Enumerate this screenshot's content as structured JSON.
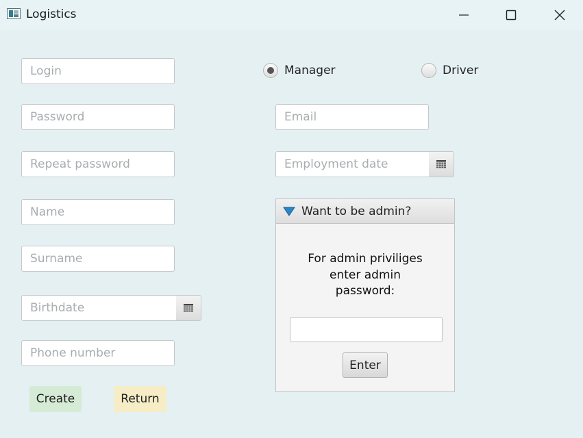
{
  "window": {
    "title": "Logistics",
    "controls": [
      "minimize-icon",
      "maximize-icon",
      "close-icon"
    ]
  },
  "form_left": {
    "login_placeholder": "Login",
    "password_placeholder": "Password",
    "repeat_password_placeholder": "Repeat password",
    "name_placeholder": "Name",
    "surname_placeholder": "Surname",
    "birthdate_placeholder": "Birthdate",
    "phone_placeholder": "Phone number"
  },
  "role": {
    "options": [
      {
        "label": "Manager",
        "selected": true
      },
      {
        "label": "Driver",
        "selected": false
      }
    ]
  },
  "form_right": {
    "email_placeholder": "Email",
    "employment_date_placeholder": "Employment date"
  },
  "admin_pane": {
    "title": "Want to be admin?",
    "expanded": true,
    "text_lines": [
      "For admin priviliges",
      "enter admin",
      "password:"
    ],
    "password_value": "",
    "enter_label": "Enter"
  },
  "actions": {
    "create_label": "Create",
    "return_label": "Return",
    "create_color": "#d6ebd6",
    "return_color": "#f6edc6"
  },
  "icons": {
    "calendar": "calendar-icon",
    "expand_arrow": "triangle-down-icon",
    "accent": "#2a87c6"
  }
}
